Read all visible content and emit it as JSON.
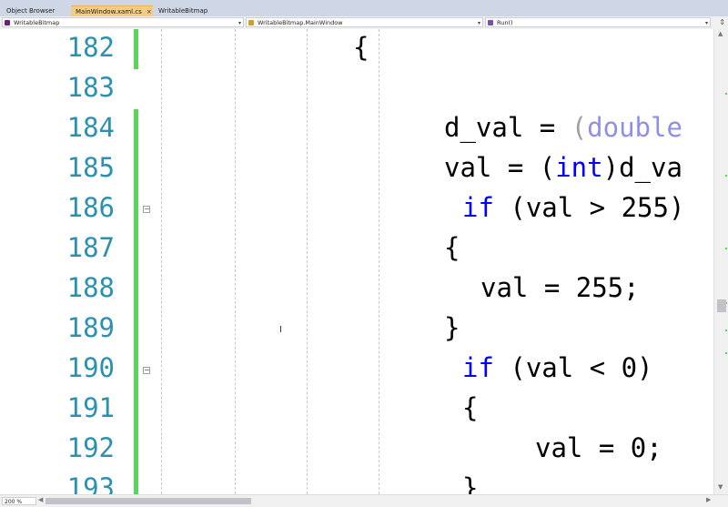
{
  "tabs": [
    {
      "label": "Object Browser",
      "active": false
    },
    {
      "label": "MainWindow.xaml.cs",
      "active": true
    },
    {
      "label": "WritableBitmap",
      "active": false
    }
  ],
  "navbar": {
    "project": "WritableBitmap",
    "class": "WritableBitmap.MainWindow",
    "member": "Run()"
  },
  "editor": {
    "lines": [
      {
        "num": "182",
        "code": [
          {
            "t": "{",
            "c": "plain"
          }
        ]
      },
      {
        "num": "183",
        "code": []
      },
      {
        "num": "184",
        "code": [
          {
            "t": "d_val = ",
            "c": "plain"
          },
          {
            "t": "(",
            "c": "paren"
          },
          {
            "t": "double",
            "c": "gray"
          }
        ]
      },
      {
        "num": "185",
        "code": [
          {
            "t": "val = (",
            "c": "plain"
          },
          {
            "t": "int",
            "c": "kw"
          },
          {
            "t": ")d_va",
            "c": "plain"
          }
        ]
      },
      {
        "num": "186",
        "code": [
          {
            "t": "if",
            "c": "kw"
          },
          {
            "t": " (val > 255)",
            "c": "plain"
          }
        ]
      },
      {
        "num": "187",
        "code": [
          {
            "t": "{",
            "c": "plain"
          }
        ]
      },
      {
        "num": "188",
        "code": [
          {
            "t": "val = 255;",
            "c": "plain"
          }
        ]
      },
      {
        "num": "189",
        "code": [
          {
            "t": "}",
            "c": "plain"
          }
        ]
      },
      {
        "num": "190",
        "code": [
          {
            "t": "if",
            "c": "kw"
          },
          {
            "t": " (val < 0)",
            "c": "plain"
          }
        ]
      },
      {
        "num": "191",
        "code": [
          {
            "t": "{",
            "c": "plain"
          }
        ]
      },
      {
        "num": "192",
        "code": [
          {
            "t": "val = 0;",
            "c": "plain"
          }
        ]
      },
      {
        "num": "193",
        "code": [
          {
            "t": "}",
            "c": "plain"
          }
        ]
      }
    ]
  },
  "statusbar": {
    "zoom": "200 %"
  },
  "icons": {
    "close": "×",
    "dropdown": "▾",
    "split": "⇕",
    "fold_minus": "−",
    "scroll_up": "▲",
    "scroll_down": "▼",
    "scroll_left": "◀",
    "scroll_right": "▶",
    "text_cursor": "I"
  }
}
